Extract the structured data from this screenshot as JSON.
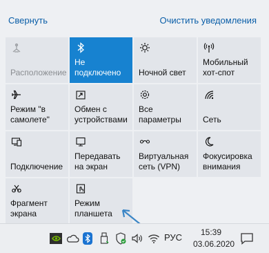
{
  "header": {
    "collapse_label": "Свернуть",
    "clear_label": "Очистить уведомления"
  },
  "tiles": [
    {
      "label": "Расположение",
      "icon": "location-icon",
      "state": "disabled"
    },
    {
      "label": "Не подключено",
      "icon": "bluetooth-icon",
      "state": "active"
    },
    {
      "label": "Ночной свет",
      "icon": "brightness-icon",
      "state": "normal"
    },
    {
      "label": "Мобильный хот-спот",
      "icon": "hotspot-icon",
      "state": "normal"
    },
    {
      "label": "Режим \"в самолете\"",
      "icon": "airplane-icon",
      "state": "normal"
    },
    {
      "label": "Обмен с устройствами",
      "icon": "share-icon",
      "state": "normal"
    },
    {
      "label": "Все параметры",
      "icon": "gear-icon",
      "state": "normal"
    },
    {
      "label": "Сеть",
      "icon": "network-icon",
      "state": "normal"
    },
    {
      "label": "Подключение",
      "icon": "connect-icon",
      "state": "normal"
    },
    {
      "label": "Передавать на экран",
      "icon": "project-icon",
      "state": "normal"
    },
    {
      "label": "Виртуальная сеть (VPN)",
      "icon": "vpn-icon",
      "state": "normal"
    },
    {
      "label": "Фокусировка внимания",
      "icon": "moon-icon",
      "state": "normal"
    },
    {
      "label": "Фрагмент экрана",
      "icon": "snip-icon",
      "state": "normal"
    },
    {
      "label": "Режим планшета",
      "icon": "tablet-icon",
      "state": "normal"
    }
  ],
  "taskbar": {
    "language": "РУС",
    "time": "15:39",
    "date": "03.06.2020",
    "icons": [
      "nvidia-icon",
      "onedrive-icon",
      "bluetooth-tray-icon",
      "usb-icon",
      "defender-icon",
      "volume-icon",
      "wifi-icon"
    ]
  },
  "colors": {
    "accent": "#1782d0",
    "link": "#0a5ea8",
    "tile_bg": "#e2e5ea",
    "arrow": "#3b86c6"
  }
}
